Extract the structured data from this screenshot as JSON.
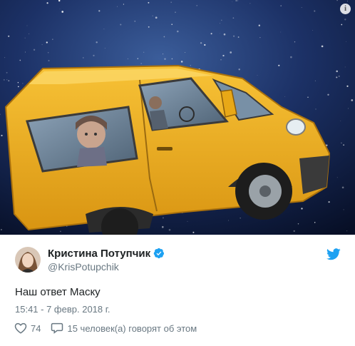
{
  "media": {
    "alt": "",
    "info_symbol": "i"
  },
  "author": {
    "name": "Кристина Потупчик",
    "handle": "@KrisPotupchik"
  },
  "tweet": {
    "text": "Наш ответ Маску",
    "timestamp": "15:41 - 7 февр. 2018 г."
  },
  "actions": {
    "likes": "74",
    "replies_label": "15 человек(а) говорят об этом"
  },
  "colors": {
    "twitter_blue": "#1da1f2",
    "van_yellow": "#f0b21c",
    "space_dark": "#0d1b3d"
  },
  "icons": {
    "verified": "verified-badge-icon",
    "bird": "twitter-bird-icon",
    "heart": "heart-icon",
    "reply": "speech-bubble-icon",
    "info": "info-icon"
  }
}
